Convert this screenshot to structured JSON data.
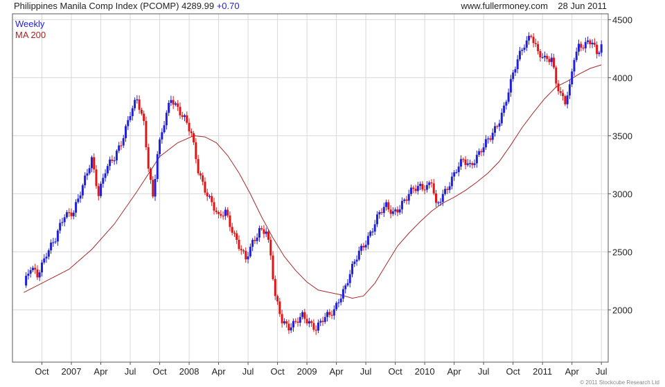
{
  "header": {
    "instrument": "Philippines Manila Comp Index (PCOMP)",
    "last": "4289.99",
    "change": "+0.70",
    "website": "www.fullermoney.com",
    "date": "28 Jun 2011"
  },
  "legend": {
    "weekly": "Weekly",
    "ma": "MA 200"
  },
  "copyright": "© 2011 Stockcube Research Ltd",
  "colors": {
    "up": "#1f1fdc",
    "down": "#e01414",
    "ma": "#a82828",
    "grid": "#d8d8d8",
    "axis": "#555555"
  },
  "chart_data": {
    "type": "line",
    "interval": "Weekly",
    "ylim": [
      1550,
      4550
    ],
    "y_ticks": [
      2000,
      2500,
      3000,
      3500,
      4000,
      4500
    ],
    "y_tick_labels": [
      "2000",
      "2500",
      "3000",
      "3500",
      "4000",
      "4500"
    ],
    "x_ticks": [
      {
        "label": "Oct",
        "week": 8
      },
      {
        "label": "2007",
        "week": 21
      },
      {
        "label": "Apr",
        "week": 34
      },
      {
        "label": "Jul",
        "week": 47
      },
      {
        "label": "Oct",
        "week": 60
      },
      {
        "label": "2008",
        "week": 73
      },
      {
        "label": "Apr",
        "week": 86
      },
      {
        "label": "Jul",
        "week": 99
      },
      {
        "label": "Oct",
        "week": 112
      },
      {
        "label": "2009",
        "week": 125
      },
      {
        "label": "Apr",
        "week": 138
      },
      {
        "label": "Jul",
        "week": 151
      },
      {
        "label": "Oct",
        "week": 164
      },
      {
        "label": "2010",
        "week": 177
      },
      {
        "label": "Apr",
        "week": 190
      },
      {
        "label": "Jul",
        "week": 203
      },
      {
        "label": "Oct",
        "week": 216
      },
      {
        "label": "2011",
        "week": 229
      },
      {
        "label": "Apr",
        "week": 242
      },
      {
        "label": "Jul",
        "week": 255
      }
    ],
    "x_range": [
      -5,
      258
    ],
    "price_anchors": [
      [
        0,
        2210
      ],
      [
        3,
        2350
      ],
      [
        6,
        2300
      ],
      [
        10,
        2500
      ],
      [
        14,
        2600
      ],
      [
        18,
        2820
      ],
      [
        22,
        2860
      ],
      [
        26,
        3050
      ],
      [
        30,
        3300
      ],
      [
        33,
        3010
      ],
      [
        36,
        3200
      ],
      [
        40,
        3300
      ],
      [
        43,
        3450
      ],
      [
        47,
        3700
      ],
      [
        50,
        3800
      ],
      [
        53,
        3600
      ],
      [
        55,
        3250
      ],
      [
        57,
        2980
      ],
      [
        59,
        3350
      ],
      [
        62,
        3600
      ],
      [
        65,
        3820
      ],
      [
        68,
        3750
      ],
      [
        71,
        3650
      ],
      [
        74,
        3500
      ],
      [
        77,
        3200
      ],
      [
        80,
        3050
      ],
      [
        83,
        2920
      ],
      [
        86,
        2780
      ],
      [
        89,
        2850
      ],
      [
        92,
        2700
      ],
      [
        95,
        2550
      ],
      [
        98,
        2420
      ],
      [
        101,
        2580
      ],
      [
        104,
        2700
      ],
      [
        107,
        2680
      ],
      [
        109,
        2450
      ],
      [
        111,
        2100
      ],
      [
        114,
        1920
      ],
      [
        117,
        1860
      ],
      [
        120,
        1880
      ],
      [
        123,
        1940
      ],
      [
        126,
        1900
      ],
      [
        129,
        1850
      ],
      [
        132,
        1910
      ],
      [
        135,
        1950
      ],
      [
        137,
        2000
      ],
      [
        139,
        2100
      ],
      [
        142,
        2200
      ],
      [
        145,
        2350
      ],
      [
        148,
        2500
      ],
      [
        151,
        2600
      ],
      [
        154,
        2700
      ],
      [
        157,
        2820
      ],
      [
        160,
        2900
      ],
      [
        163,
        2850
      ],
      [
        166,
        2880
      ],
      [
        169,
        2950
      ],
      [
        172,
        3050
      ],
      [
        175,
        3080
      ],
      [
        178,
        3050
      ],
      [
        180,
        3100
      ],
      [
        182,
        2880
      ],
      [
        185,
        3000
      ],
      [
        188,
        3100
      ],
      [
        191,
        3200
      ],
      [
        194,
        3280
      ],
      [
        197,
        3250
      ],
      [
        200,
        3330
      ],
      [
        203,
        3400
      ],
      [
        206,
        3480
      ],
      [
        209,
        3600
      ],
      [
        212,
        3750
      ],
      [
        215,
        3950
      ],
      [
        218,
        4150
      ],
      [
        221,
        4300
      ],
      [
        224,
        4380
      ],
      [
        227,
        4200
      ],
      [
        230,
        4150
      ],
      [
        233,
        4180
      ],
      [
        235,
        3980
      ],
      [
        237,
        3850
      ],
      [
        239,
        3780
      ],
      [
        241,
        3900
      ],
      [
        243,
        4180
      ],
      [
        245,
        4280
      ],
      [
        248,
        4300
      ],
      [
        251,
        4300
      ],
      [
        253,
        4180
      ],
      [
        255,
        4290
      ]
    ],
    "ma_anchors": [
      [
        0,
        2150
      ],
      [
        10,
        2250
      ],
      [
        20,
        2350
      ],
      [
        30,
        2520
      ],
      [
        40,
        2740
      ],
      [
        50,
        3020
      ],
      [
        60,
        3320
      ],
      [
        68,
        3440
      ],
      [
        75,
        3500
      ],
      [
        80,
        3490
      ],
      [
        85,
        3440
      ],
      [
        90,
        3330
      ],
      [
        95,
        3180
      ],
      [
        100,
        3000
      ],
      [
        105,
        2800
      ],
      [
        110,
        2620
      ],
      [
        115,
        2460
      ],
      [
        120,
        2340
      ],
      [
        125,
        2240
      ],
      [
        130,
        2170
      ],
      [
        135,
        2150
      ],
      [
        140,
        2130
      ],
      [
        145,
        2100
      ],
      [
        150,
        2120
      ],
      [
        155,
        2230
      ],
      [
        160,
        2390
      ],
      [
        165,
        2550
      ],
      [
        170,
        2660
      ],
      [
        175,
        2760
      ],
      [
        180,
        2850
      ],
      [
        185,
        2920
      ],
      [
        190,
        2970
      ],
      [
        195,
        3030
      ],
      [
        200,
        3100
      ],
      [
        205,
        3180
      ],
      [
        210,
        3280
      ],
      [
        215,
        3420
      ],
      [
        220,
        3570
      ],
      [
        225,
        3700
      ],
      [
        230,
        3820
      ],
      [
        235,
        3920
      ],
      [
        240,
        3970
      ],
      [
        245,
        4030
      ],
      [
        250,
        4080
      ],
      [
        255,
        4110
      ]
    ]
  }
}
